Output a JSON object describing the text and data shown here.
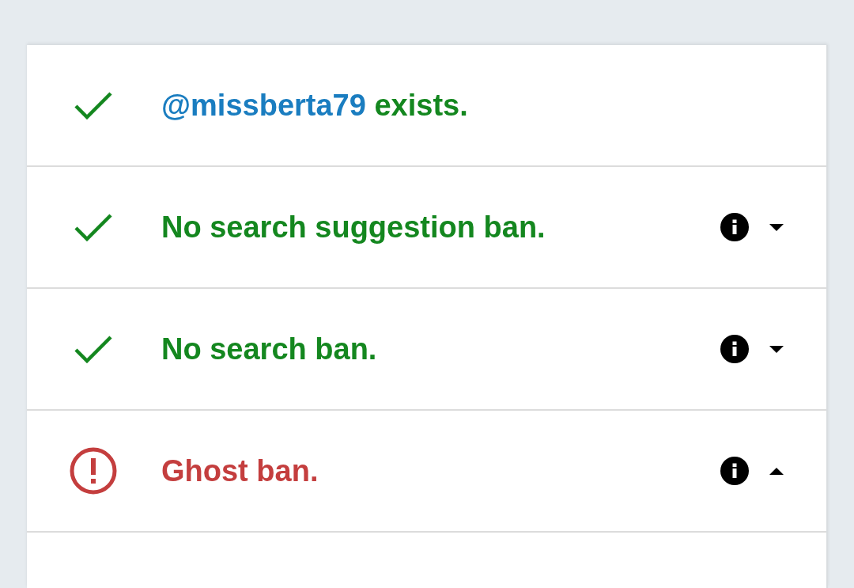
{
  "checks": [
    {
      "kind": "account",
      "passed": true,
      "handle": "@missberta79",
      "text": "exists."
    },
    {
      "kind": "ban",
      "passed": true,
      "text": "No search suggestion ban.",
      "expanded": false
    },
    {
      "kind": "ban",
      "passed": true,
      "text": "No search ban.",
      "expanded": false
    },
    {
      "kind": "ban",
      "passed": false,
      "text": "Ghost ban.",
      "expanded": true
    }
  ]
}
